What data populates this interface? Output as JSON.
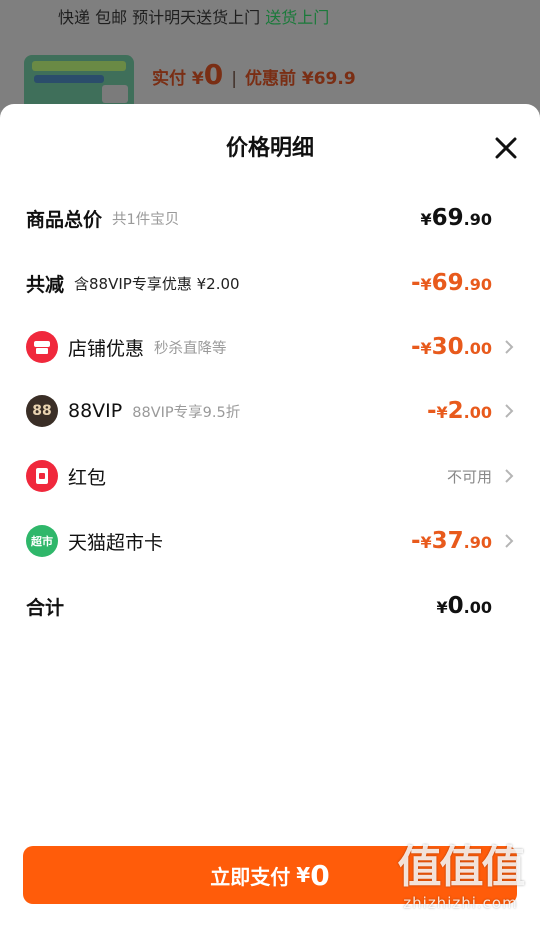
{
  "background": {
    "shipping_prefix": "快递 包邮  预计明天送货上门",
    "shipping_highlight": "送货上门",
    "price_prefix": "实付 ¥",
    "price_value": "0",
    "price_original": "优惠前 ¥69.9"
  },
  "sheet": {
    "title": "价格明细"
  },
  "rows": {
    "total": {
      "label": "商品总价",
      "sub": "共1件宝贝",
      "cur": "¥",
      "int": "69",
      "dec": ".90"
    },
    "reduce": {
      "label": "共减",
      "sub": "含88VIP专享优惠 ¥2.00",
      "sign": "-",
      "cur": "¥",
      "int": "69",
      "dec": ".90"
    },
    "store": {
      "label": "店铺优惠",
      "sub": "秒杀直降等",
      "sign": "-",
      "cur": "¥",
      "int": "30",
      "dec": ".00"
    },
    "vip": {
      "icon_text": "88",
      "label": "88VIP",
      "sub": "88VIP专享9.5折",
      "sign": "-",
      "cur": "¥",
      "int": "2",
      "dec": ".00"
    },
    "redpacket": {
      "label": "红包",
      "status": "不可用"
    },
    "tmcard": {
      "icon_text": "超市",
      "label": "天猫超市卡",
      "sign": "-",
      "cur": "¥",
      "int": "37",
      "dec": ".90"
    },
    "sum": {
      "label": "合计",
      "cur": "¥",
      "int": "0",
      "dec": ".00"
    }
  },
  "pay_button": {
    "label": "立即支付",
    "cur": "¥",
    "amount": "0"
  },
  "watermark": {
    "big": "值值值",
    "small": "zhizhizhi.com"
  },
  "colors": {
    "accent": "#ff5c0a",
    "discount": "#e85a1c"
  },
  "icons": {
    "close": "close-icon",
    "chevron": "chevron-right-icon",
    "store": "store-icon",
    "vip": "vip88-icon",
    "redpacket": "red-packet-icon",
    "tmcard": "tmall-supermarket-icon"
  }
}
